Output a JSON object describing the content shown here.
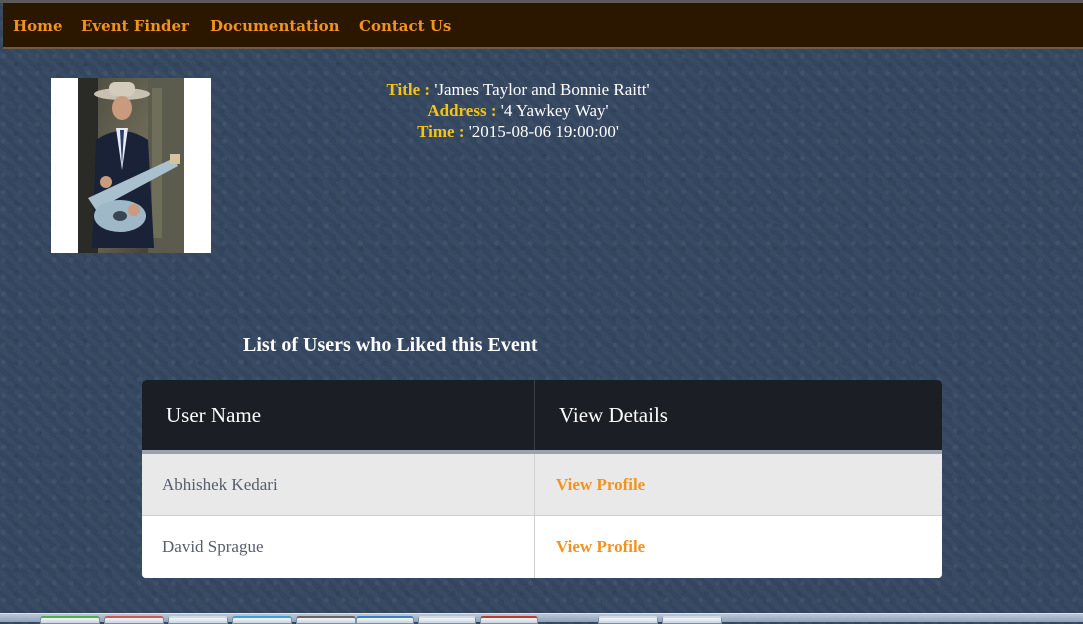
{
  "nav": {
    "home": "Home",
    "event_finder": "Event Finder",
    "documentation": "Documentation",
    "contact_us": "Contact Us"
  },
  "event": {
    "title_label": "Title :",
    "title_value": "'James Taylor and Bonnie Raitt'",
    "address_label": "Address :",
    "address_value": "'4 Yawkey Way'",
    "time_label": "Time :",
    "time_value": "'2015-08-06 19:00:00'"
  },
  "likes": {
    "heading": "List of Users who Liked this Event",
    "columns": [
      "User Name",
      "View Details"
    ],
    "rows": [
      {
        "user_name": "Abhishek Kedari",
        "action": "View Profile"
      },
      {
        "user_name": "David Sprague",
        "action": "View Profile"
      }
    ]
  },
  "colors": {
    "nav_background": "#2b1600",
    "nav_link": "#f2931f",
    "page_background": "#34465f",
    "label_gold": "#f5c314",
    "table_header": "#1c1e26",
    "link_orange": "#f2931f"
  },
  "icons": {
    "event_photo": "performer-photo"
  },
  "taskbar": {
    "buttons": [
      {
        "name": "taskbar-button-1",
        "color": "#4caf50"
      },
      {
        "name": "taskbar-button-2",
        "color": "#d9534f"
      },
      {
        "name": "taskbar-button-3",
        "color": "#cfd8e3"
      },
      {
        "name": "taskbar-button-4",
        "color": "#3aa0d8"
      },
      {
        "name": "taskbar-button-5",
        "color": "#666666"
      },
      {
        "name": "taskbar-button-6",
        "color": "#3a7fc4"
      },
      {
        "name": "taskbar-button-7",
        "color": "#cfd8e3"
      },
      {
        "name": "taskbar-button-8",
        "color": "#c0392b"
      },
      {
        "name": "taskbar-button-9",
        "color": "#cfd8e3"
      },
      {
        "name": "taskbar-button-10",
        "color": "#cfd8e3"
      }
    ]
  }
}
